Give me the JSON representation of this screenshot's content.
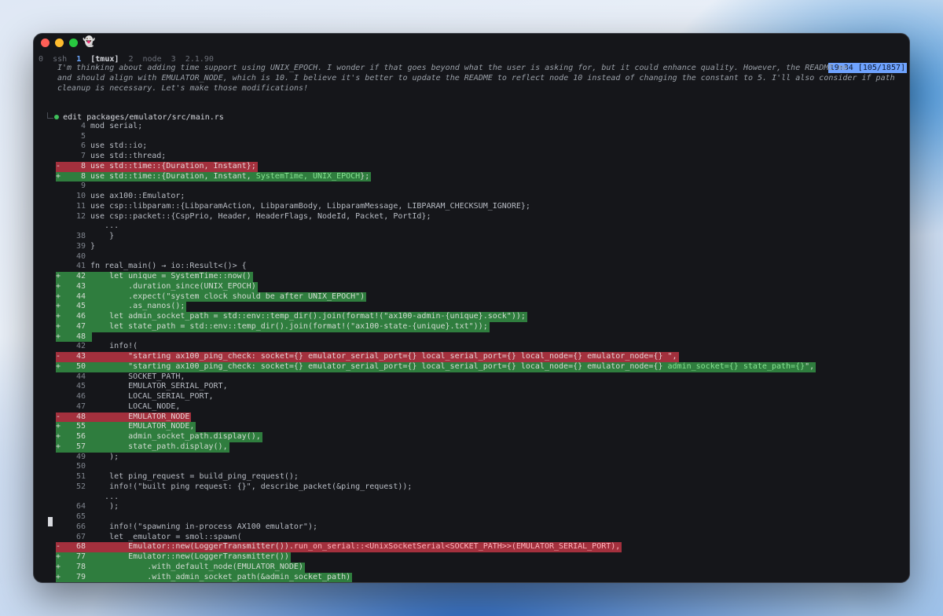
{
  "window": {
    "title_icon": "ghost-icon"
  },
  "tmux": {
    "segments": [
      {
        "num": "0",
        "name": "ssh",
        "active": false
      },
      {
        "num": "1",
        "name": "[tmux]",
        "active": true
      },
      {
        "num": "2",
        "name": "node",
        "active": false
      },
      {
        "num": "3",
        "name": "2.1.90",
        "active": false
      }
    ],
    "status": "19:34 [105/1857]"
  },
  "thinking": {
    "lines": [
      "I'm thinking about adding time support using UNIX_EPOCH. I wonder if that goes beyond what the user is asking for, but it could enhance quality. However, the README me",
      "and should align with EMULATOR_NODE, which is 10. I believe it's better to update the README to reflect node 10 instead of changing the constant to 5. I'll also consider if path",
      "cleanup is necessary. Let's make those modifications!"
    ]
  },
  "edit": {
    "verb": "edit",
    "path": "packages/emulator/src/main.rs"
  },
  "diff": [
    {
      "type": "ctx",
      "sign": "",
      "num": "",
      "code": "   ..."
    },
    {
      "type": "ctx",
      "sign": "",
      "num": "4",
      "code": "mod serial;"
    },
    {
      "type": "ctx",
      "sign": "",
      "num": "5",
      "code": ""
    },
    {
      "type": "ctx",
      "sign": "",
      "num": "6",
      "code": "use std::io;"
    },
    {
      "type": "ctx",
      "sign": "",
      "num": "7",
      "code": "use std::thread;"
    },
    {
      "type": "del",
      "sign": "-",
      "num": "8",
      "code": "use std::time::{Duration, Instant};"
    },
    {
      "type": "add",
      "sign": "+",
      "num": "8",
      "code": "use std::time::{Duration, Instant, ",
      "hl": "SystemTime, UNIX_EPOCH",
      "tail": "};"
    },
    {
      "type": "ctx",
      "sign": "",
      "num": "9",
      "code": ""
    },
    {
      "type": "ctx",
      "sign": "",
      "num": "10",
      "code": "use ax100::Emulator;"
    },
    {
      "type": "ctx",
      "sign": "",
      "num": "11",
      "code": "use csp::libparam::{LibparamAction, LibparamBody, LibparamMessage, LIBPARAM_CHECKSUM_IGNORE};"
    },
    {
      "type": "ctx",
      "sign": "",
      "num": "12",
      "code": "use csp::packet::{CspPrio, Header, HeaderFlags, NodeId, Packet, PortId};"
    },
    {
      "type": "ctx",
      "sign": "",
      "num": "",
      "code": "   ..."
    },
    {
      "type": "ctx",
      "sign": "",
      "num": "38",
      "code": "    }"
    },
    {
      "type": "ctx",
      "sign": "",
      "num": "39",
      "code": "}"
    },
    {
      "type": "ctx",
      "sign": "",
      "num": "40",
      "code": ""
    },
    {
      "type": "ctx",
      "sign": "",
      "num": "41",
      "code": "fn real_main() → io::Result<()> {"
    },
    {
      "type": "add",
      "sign": "+",
      "num": "42",
      "code": "    let unique = SystemTime::now()"
    },
    {
      "type": "add",
      "sign": "+",
      "num": "43",
      "code": "        .duration_since(UNIX_EPOCH)"
    },
    {
      "type": "add",
      "sign": "+",
      "num": "44",
      "code": "        .expect(\"system clock should be after UNIX_EPOCH\")"
    },
    {
      "type": "add",
      "sign": "+",
      "num": "45",
      "code": "        .as_nanos();"
    },
    {
      "type": "add",
      "sign": "+",
      "num": "46",
      "code": "    let admin_socket_path = std::env::temp_dir().join(format!(\"ax100-admin-{unique}.sock\"));"
    },
    {
      "type": "add",
      "sign": "+",
      "num": "47",
      "code": "    let state_path = std::env::temp_dir().join(format!(\"ax100-state-{unique}.txt\"));"
    },
    {
      "type": "add",
      "sign": "+",
      "num": "48",
      "code": ""
    },
    {
      "type": "ctx",
      "sign": "",
      "num": "42",
      "code": "    info!("
    },
    {
      "type": "del",
      "sign": "-",
      "num": "43",
      "code": "        \"starting ax100_ping_check: socket={} emulator_serial_port={} local_serial_port={} local_node={} emulator_node={} \","
    },
    {
      "type": "add",
      "sign": "+",
      "num": "50",
      "code": "        \"starting ax100_ping_check: socket={} emulator_serial_port={} local_serial_port={} local_node={} emulator_node={} ",
      "hl": "admin_socket={} state_path={}",
      "tail": "\","
    },
    {
      "type": "ctx",
      "sign": "",
      "num": "44",
      "code": "        SOCKET_PATH,"
    },
    {
      "type": "ctx",
      "sign": "",
      "num": "45",
      "code": "        EMULATOR_SERIAL_PORT,"
    },
    {
      "type": "ctx",
      "sign": "",
      "num": "46",
      "code": "        LOCAL_SERIAL_PORT,"
    },
    {
      "type": "ctx",
      "sign": "",
      "num": "47",
      "code": "        LOCAL_NODE,"
    },
    {
      "type": "del",
      "sign": "-",
      "num": "48",
      "code": "        EMULATOR_NODE"
    },
    {
      "type": "add",
      "sign": "+",
      "num": "55",
      "code": "        EMULATOR_NODE,"
    },
    {
      "type": "add",
      "sign": "+",
      "num": "56",
      "code": "        admin_socket_path.display(),"
    },
    {
      "type": "add",
      "sign": "+",
      "num": "57",
      "code": "        state_path.display(),"
    },
    {
      "type": "ctx",
      "sign": "",
      "num": "49",
      "code": "    );"
    },
    {
      "type": "ctx",
      "sign": "",
      "num": "50",
      "code": ""
    },
    {
      "type": "ctx",
      "sign": "",
      "num": "51",
      "code": "    let ping_request = build_ping_request();"
    },
    {
      "type": "ctx",
      "sign": "",
      "num": "52",
      "code": "    info!(\"built ping request: {}\", describe_packet(&ping_request));"
    },
    {
      "type": "ctx",
      "sign": "",
      "num": "",
      "code": "   ..."
    },
    {
      "type": "ctx",
      "sign": "",
      "num": "64",
      "code": "    );"
    },
    {
      "type": "ctx",
      "sign": "",
      "num": "65",
      "code": ""
    },
    {
      "type": "ctx",
      "sign": "",
      "num": "66",
      "code": "    info!(\"spawning in-process AX100 emulator\");"
    },
    {
      "type": "ctx",
      "sign": "",
      "num": "67",
      "code": "    let _emulator = smol::spawn("
    },
    {
      "type": "del",
      "sign": "-",
      "num": "68",
      "code": "        Emulator::new(LoggerTransmitter()).",
      "hl": "run_on_serial::<UnixSocketSerial<SOCKET_PATH>>(EMULATOR_SERIAL_PORT),",
      "tail": ""
    },
    {
      "type": "add",
      "sign": "+",
      "num": "77",
      "code": "        Emulator::new(LoggerTransmitter())"
    },
    {
      "type": "add",
      "sign": "+",
      "num": "78",
      "code": "            .with_default_node(EMULATOR_NODE)"
    },
    {
      "type": "add",
      "sign": "+",
      "num": "79",
      "code": "            .with_admin_socket_path(&admin_socket_path)"
    }
  ]
}
